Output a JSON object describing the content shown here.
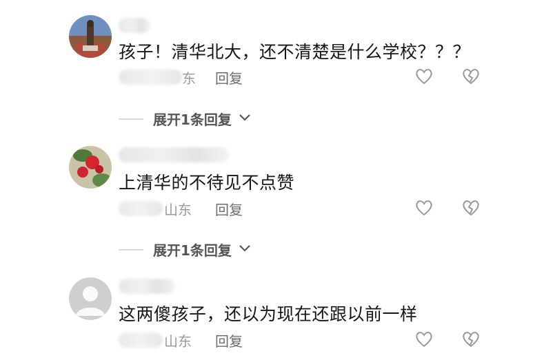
{
  "comments": [
    {
      "text": "孩子！清华北大，还不清楚是什么学校？？？",
      "location_fragment": "东",
      "reply_label": "回复",
      "expand_label": "展开1条回复"
    },
    {
      "text": "上清华的不待见不点赞",
      "location_fragment": "山东",
      "reply_label": "回复",
      "expand_label": "展开1条回复"
    },
    {
      "text": "这两傻孩子，还以为现在还跟以前一样",
      "location_fragment": "山东",
      "reply_label": "回复"
    }
  ],
  "icons": {
    "like": "heart-outline-icon",
    "dislike": "broken-heart-icon",
    "expand": "chevron-down-icon"
  }
}
